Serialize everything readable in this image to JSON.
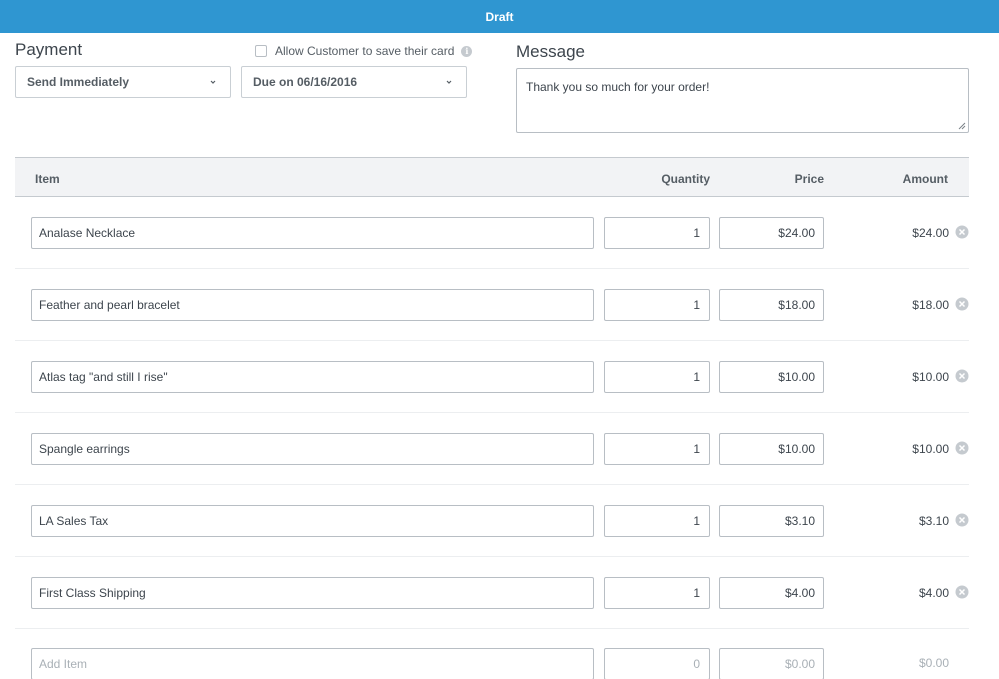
{
  "header": {
    "title": "Draft"
  },
  "payment": {
    "title": "Payment",
    "send_select": "Send Immediately",
    "due_select": "Due on 06/16/2016",
    "allow_label": "Allow Customer to save their card",
    "info_glyph": "i"
  },
  "message": {
    "title": "Message",
    "text": "Thank you so much for your order!"
  },
  "table": {
    "headers": {
      "item": "Item",
      "quantity": "Quantity",
      "price": "Price",
      "amount": "Amount"
    },
    "rows": [
      {
        "item": "Analase Necklace",
        "quantity": "1",
        "price": "$24.00",
        "amount": "$24.00"
      },
      {
        "item": "Feather and pearl bracelet",
        "quantity": "1",
        "price": "$18.00",
        "amount": "$18.00"
      },
      {
        "item": "Atlas tag \"and still I rise\"",
        "quantity": "1",
        "price": "$10.00",
        "amount": "$10.00"
      },
      {
        "item": "Spangle earrings",
        "quantity": "1",
        "price": "$10.00",
        "amount": "$10.00"
      },
      {
        "item": "LA Sales Tax",
        "quantity": "1",
        "price": "$3.10",
        "amount": "$3.10"
      },
      {
        "item": "First Class Shipping",
        "quantity": "1",
        "price": "$4.00",
        "amount": "$4.00"
      }
    ],
    "new_row": {
      "item_placeholder": "Add Item",
      "quantity": "0",
      "price": "$0.00",
      "amount": "$0.00"
    }
  },
  "icons": {
    "chevron": "chevron-down-icon",
    "remove": "remove-circle-icon",
    "info": "info-icon",
    "resize": "resize-grip-icon"
  },
  "colors": {
    "topbar": "#2f96d1",
    "border": "#b8bec4",
    "header_bg": "#f2f3f5",
    "placeholder": "#a9b0b6"
  }
}
